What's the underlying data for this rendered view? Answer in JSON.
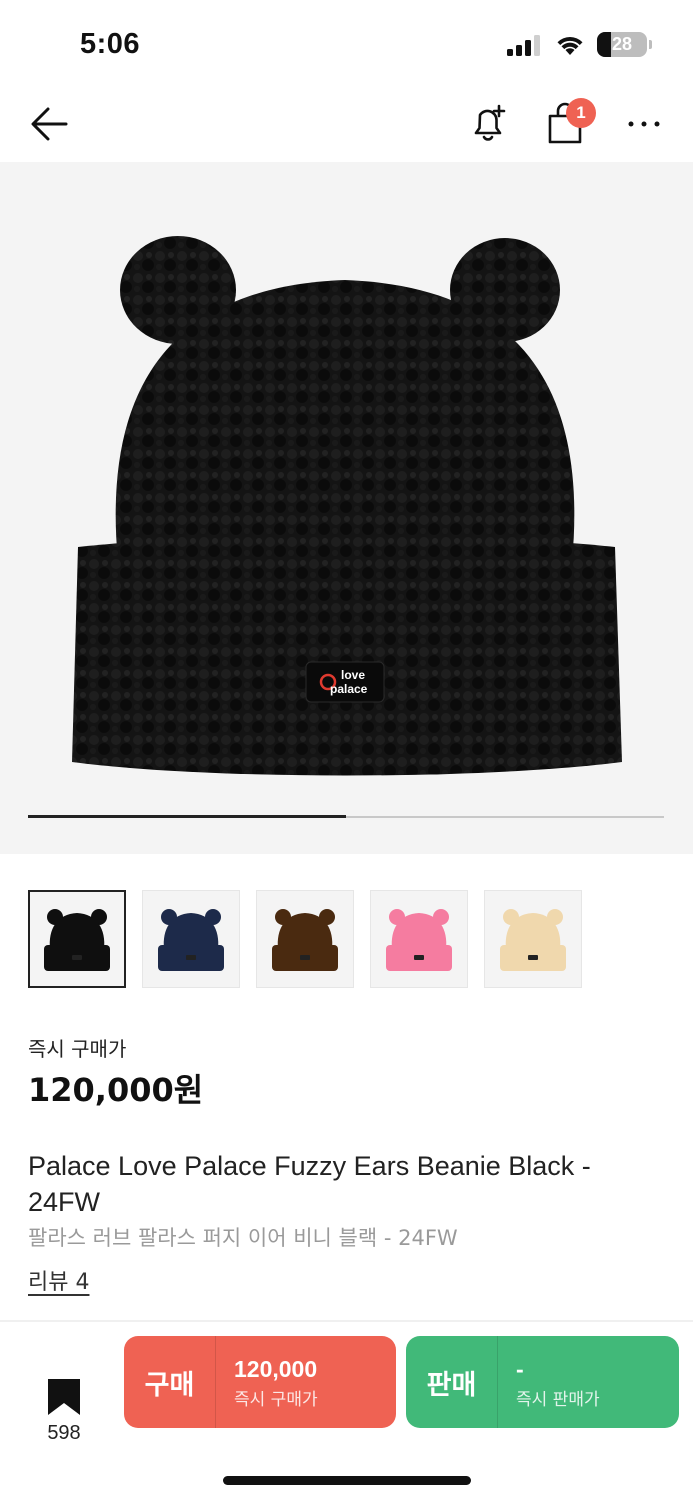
{
  "status_bar": {
    "time": "5:06",
    "battery": "28"
  },
  "nav": {
    "cart_badge": "1"
  },
  "gallery": {
    "progress": 0.5
  },
  "thumbnails": [
    {
      "color": "#0f0f0f"
    },
    {
      "color": "#1d2a4a"
    },
    {
      "color": "#4a2a10"
    },
    {
      "color": "#f57ca0"
    },
    {
      "color": "#f0d8ad"
    }
  ],
  "product": {
    "price_label": "즉시 구매가",
    "price": "120,000원",
    "title_en": "Palace Love Palace Fuzzy Ears Beanie Black - 24FW",
    "title_ko": "팔라스 러브 팔라스 퍼지 이어 비니 블랙 - 24FW",
    "review": "리뷰 4"
  },
  "bottom_bar": {
    "wish_count": "598",
    "buy": {
      "label": "구매",
      "value": "120,000",
      "caption": "즉시 구매가"
    },
    "sell": {
      "label": "판매",
      "value": "-",
      "caption": "즉시 판매가"
    }
  },
  "colors": {
    "buy": "#ef6253",
    "sell": "#41b979",
    "badge": "#ef6253"
  }
}
